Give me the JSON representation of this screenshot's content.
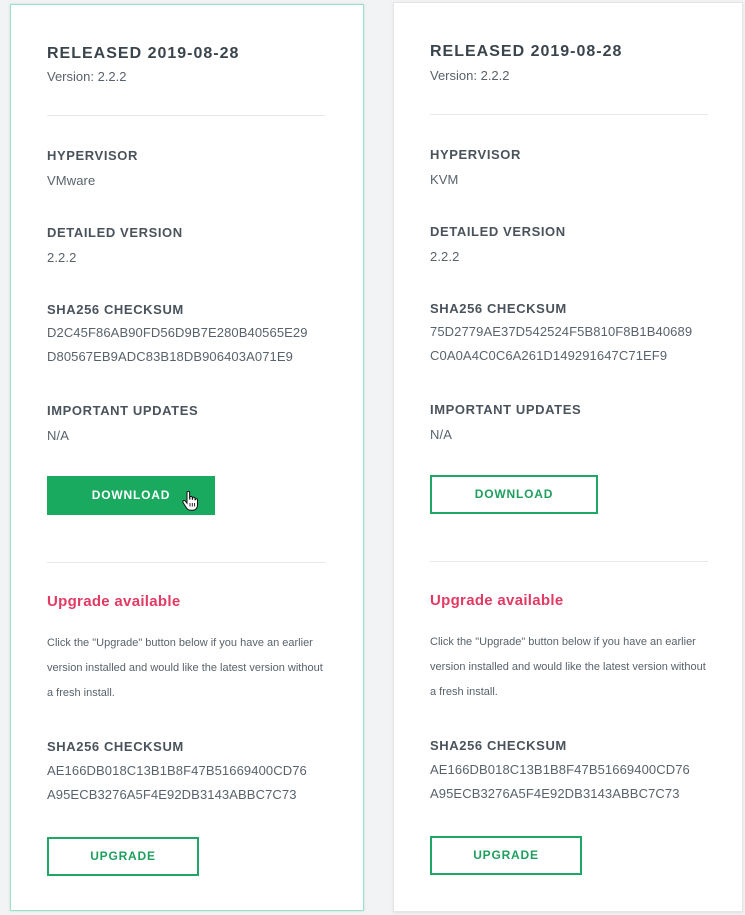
{
  "cards": [
    {
      "released": "RELEASED 2019-08-28",
      "version": "Version: 2.2.2",
      "hypervisor_label": "HYPERVISOR",
      "hypervisor_value": "VMware",
      "detailed_version_label": "DETAILED VERSION",
      "detailed_version_value": "2.2.2",
      "checksum_label": "SHA256 CHECKSUM",
      "checksum_line1": "D2C45F86AB90FD56D9B7E280B40565E29",
      "checksum_line2": "D80567EB9ADC83B18DB906403A071E9",
      "updates_label": "IMPORTANT UPDATES",
      "updates_value": "N/A",
      "download_label": "DOWNLOAD",
      "upgrade_title": "Upgrade available",
      "upgrade_desc": "Click the \"Upgrade\" button below if you have an earlier version installed and would like the latest version without a fresh install.",
      "upgrade_checksum_label": "SHA256 CHECKSUM",
      "upgrade_checksum_line1": "AE166DB018C13B1B8F47B51669400CD76",
      "upgrade_checksum_line2": "A95ECB3276A5F4E92DB3143ABBC7C73",
      "upgrade_button_label": "UPGRADE"
    },
    {
      "released": "RELEASED 2019-08-28",
      "version": "Version: 2.2.2",
      "hypervisor_label": "HYPERVISOR",
      "hypervisor_value": "KVM",
      "detailed_version_label": "DETAILED VERSION",
      "detailed_version_value": "2.2.2",
      "checksum_label": "SHA256 CHECKSUM",
      "checksum_line1": "75D2779AE37D542524F5B810F8B1B40689",
      "checksum_line2": "C0A0A4C0C6A261D149291647C71EF9",
      "updates_label": "IMPORTANT UPDATES",
      "updates_value": "N/A",
      "download_label": "DOWNLOAD",
      "upgrade_title": "Upgrade available",
      "upgrade_desc": "Click the \"Upgrade\" button below if you have an earlier version installed and would like the latest version without a fresh install.",
      "upgrade_checksum_label": "SHA256 CHECKSUM",
      "upgrade_checksum_line1": "AE166DB018C13B1B8F47B51669400CD76",
      "upgrade_checksum_line2": "A95ECB3276A5F4E92DB3143ABBC7C73",
      "upgrade_button_label": "UPGRADE"
    }
  ],
  "colors": {
    "accent_green": "#1aaa5f",
    "upgrade_pink": "#e23a63",
    "selected_border": "#9fe0cc"
  },
  "icons": {
    "cursor": "hand-pointer-icon"
  }
}
